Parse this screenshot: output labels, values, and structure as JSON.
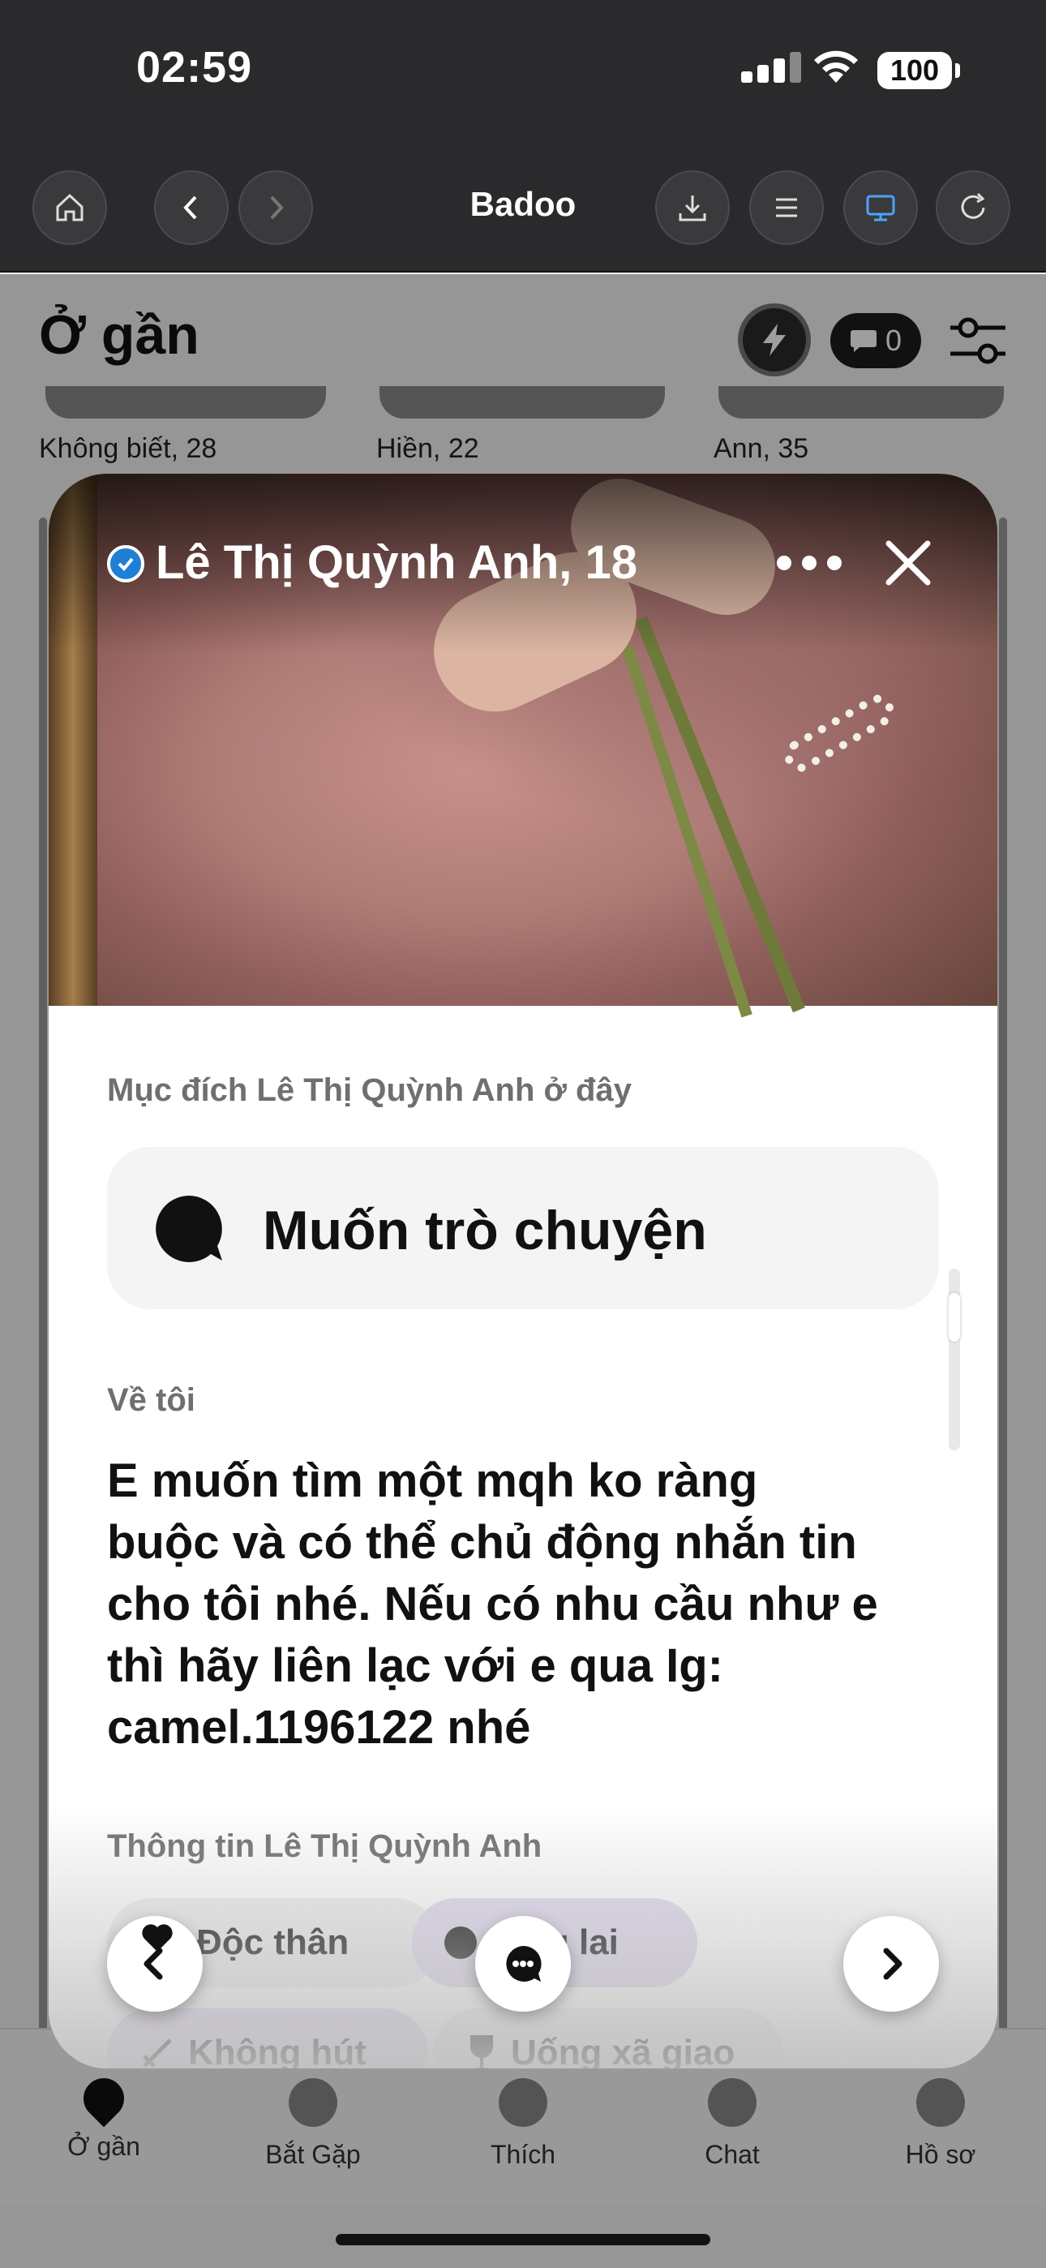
{
  "status_bar": {
    "time": "02:59",
    "battery": "100"
  },
  "browser": {
    "title": "Badoo"
  },
  "background": {
    "title": "Ở gần",
    "chat_count": "0",
    "people": [
      "Không biết, 28",
      "Hiền, 22",
      "Ann, 35"
    ]
  },
  "tabs": [
    {
      "label": "Ở gần"
    },
    {
      "label": "Bắt Gặp"
    },
    {
      "label": "Thích"
    },
    {
      "label": "Chat"
    },
    {
      "label": "Hồ sơ"
    }
  ],
  "profile": {
    "name": "Lê Thị Quỳnh Anh, 18",
    "intent_label": "Mục đích Lê Thị Quỳnh Anh ở đây",
    "intent": "Muốn trò chuyện",
    "about_label": "Về tôi",
    "about_lines": [
      "E muốn tìm một mqh ko ràng",
      "buộc và có thể chủ động nhắn tin",
      "cho tôi nhé. Nếu có nhu cầu như e",
      "thì hãy liên lạc với e qua Ig:",
      "camel.1196122 nhé"
    ],
    "info_label": "Thông tin Lê Thị Quỳnh Anh",
    "chips": [
      "Độc thân",
      "ng lai",
      "Không hút",
      "Uống xã giao"
    ]
  },
  "colors": {
    "verified": "#1f7fd6",
    "toolbar_active": "#4da3ff"
  }
}
